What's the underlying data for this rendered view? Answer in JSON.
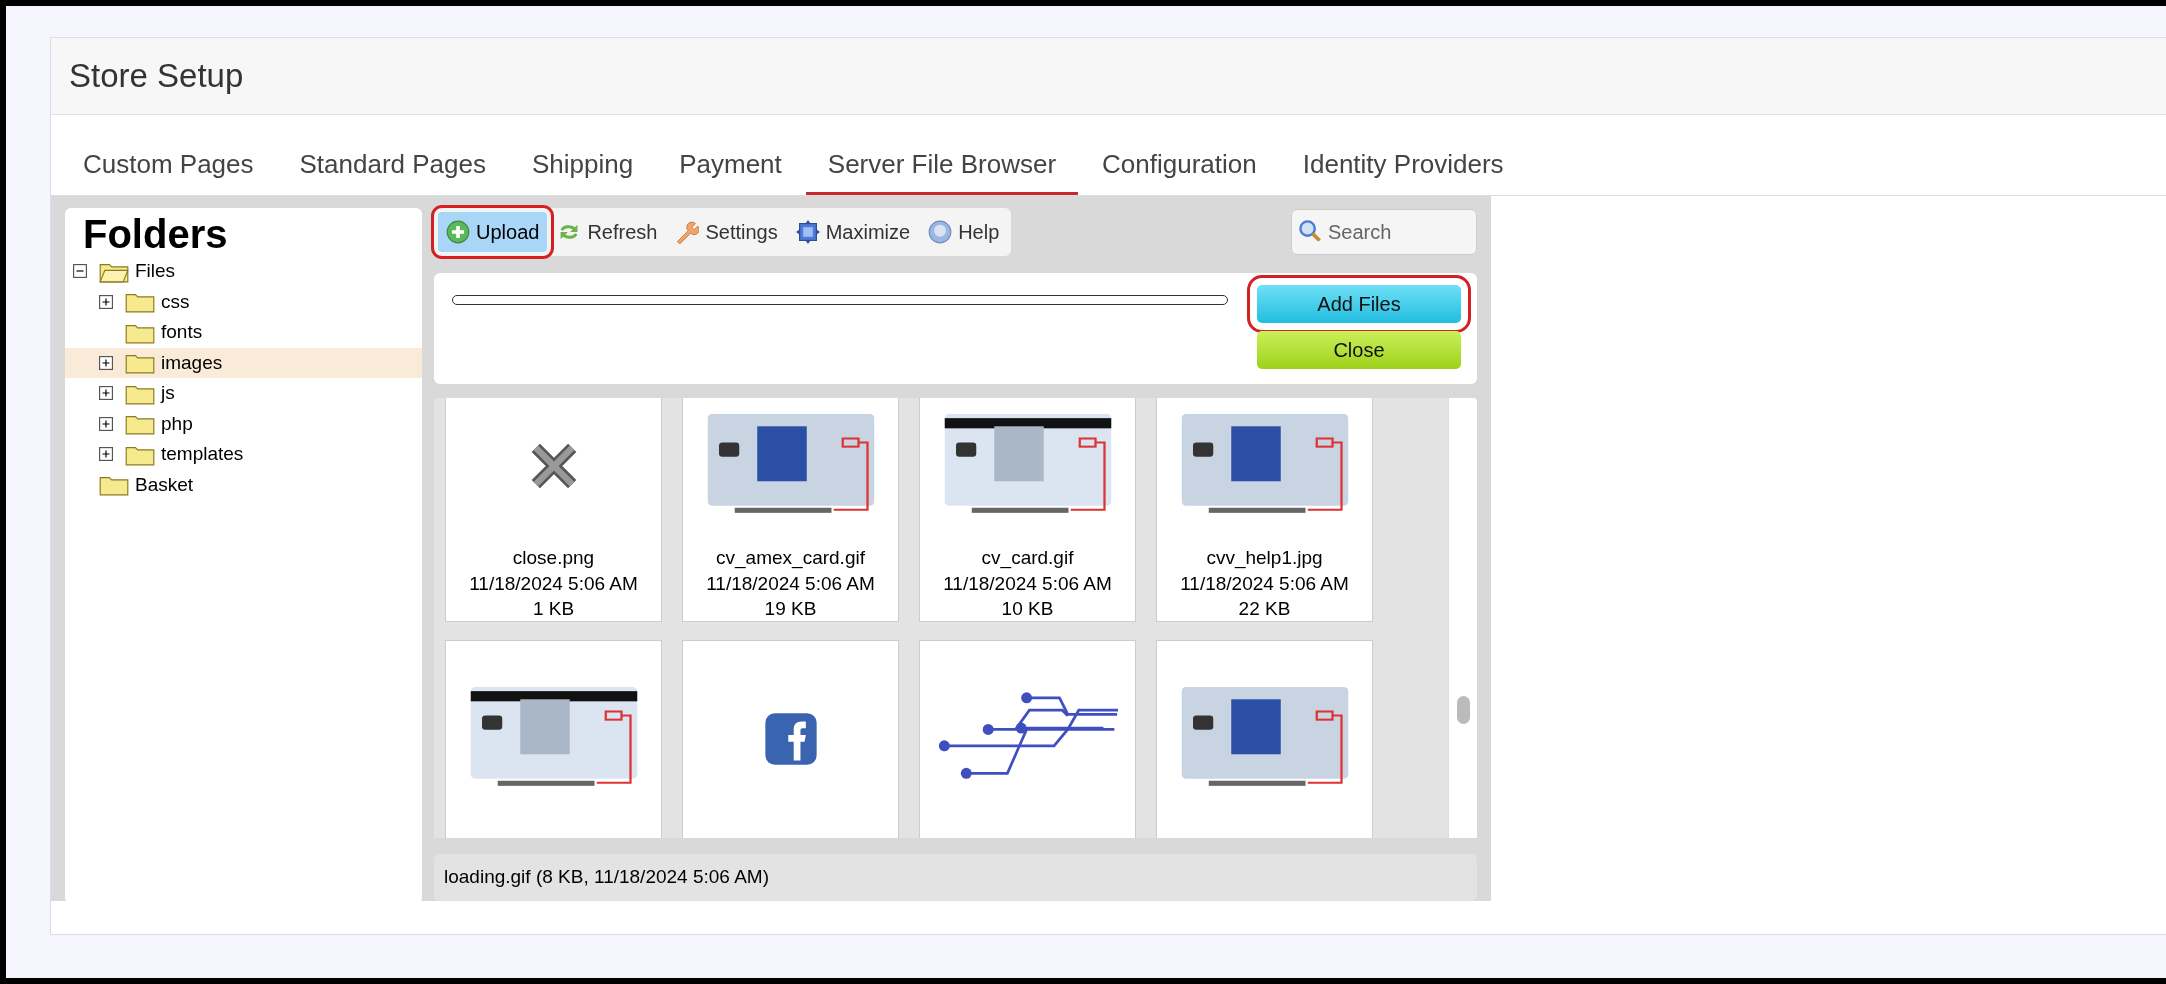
{
  "window": {
    "title": "Store Setup"
  },
  "tabs": [
    {
      "label": "Custom Pages",
      "selected": false
    },
    {
      "label": "Standard Pages",
      "selected": false
    },
    {
      "label": "Shipping",
      "selected": false
    },
    {
      "label": "Payment",
      "selected": false
    },
    {
      "label": "Server File Browser",
      "selected": true
    },
    {
      "label": "Configuration",
      "selected": false
    },
    {
      "label": "Identity Providers",
      "selected": false
    }
  ],
  "folders": {
    "title": "Folders",
    "tree": [
      {
        "label": "Files",
        "expanded": true,
        "selected": false,
        "children": [
          {
            "label": "css",
            "expanded": false,
            "selected": false
          },
          {
            "label": "fonts",
            "selected": false
          },
          {
            "label": "images",
            "expanded": false,
            "selected": true
          },
          {
            "label": "js",
            "expanded": false,
            "selected": false
          },
          {
            "label": "php",
            "expanded": false,
            "selected": false
          },
          {
            "label": "templates",
            "expanded": false,
            "selected": false
          }
        ]
      },
      {
        "label": "Basket",
        "selected": false
      }
    ]
  },
  "toolbar": [
    {
      "label": "Upload",
      "selected": true,
      "highlighted": true
    },
    {
      "label": "Refresh",
      "selected": false,
      "highlighted": false
    },
    {
      "label": "Settings",
      "selected": false,
      "highlighted": false
    },
    {
      "label": "Maximize",
      "selected": false,
      "highlighted": false
    },
    {
      "label": "Help",
      "selected": false,
      "highlighted": false
    }
  ],
  "search": {
    "placeholder": "Search"
  },
  "upload_panel": {
    "progress": {
      "level": 0
    },
    "buttons": [
      {
        "label": "Add Files",
        "kind": "add",
        "highlighted": true
      },
      {
        "label": "Close",
        "kind": "close",
        "highlighted": false
      }
    ]
  },
  "files": [
    {
      "name": "close.png",
      "date": "11/18/2024 5:06 AM",
      "size": "1 KB",
      "kind": "x"
    },
    {
      "name": "cv_amex_card.gif",
      "date": "11/18/2024 5:06 AM",
      "size": "19 KB",
      "kind": "picture"
    },
    {
      "name": "cv_card.gif",
      "date": "11/18/2024 5:06 AM",
      "size": "10 KB",
      "kind": "picture"
    },
    {
      "name": "cvv_help1.jpg",
      "date": "11/18/2024 5:06 AM",
      "size": "22 KB",
      "kind": "picture"
    },
    {
      "kind": "picture"
    },
    {
      "kind": "facebook"
    },
    {
      "kind": "circuit"
    },
    {
      "kind": "picture"
    }
  ],
  "status_bar": "loading.gif (8 KB, 11/18/2024 5:06 AM)"
}
